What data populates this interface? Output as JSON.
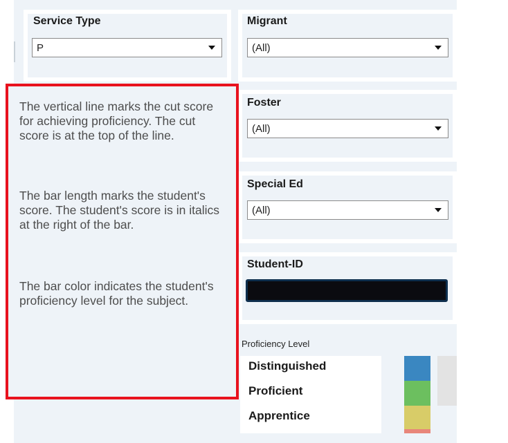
{
  "filters": {
    "service_type": {
      "label": "Service Type",
      "value": "P"
    },
    "migrant": {
      "label": "Migrant",
      "value": "(All)"
    },
    "foster": {
      "label": "Foster",
      "value": "(All)"
    },
    "special_ed": {
      "label": "Special Ed",
      "value": "(All)"
    },
    "student_id": {
      "label": "Student-ID",
      "value": ""
    }
  },
  "info": {
    "paragraph1": "The vertical line marks the cut score for achieving proficiency. The cut score is at the top of the line.",
    "paragraph2": "The bar length marks the student's score. The student's score is in italics at the right of the bar.",
    "paragraph3": "The bar color indicates the student's proficiency level for the subject."
  },
  "legend": {
    "title": "Proficiency Level",
    "items": [
      {
        "label": "Distinguished",
        "color": "#3a87c1"
      },
      {
        "label": "Proficient",
        "color": "#6cbf5f"
      },
      {
        "label": "Apprentice",
        "color": "#d8cc68"
      }
    ],
    "extra_color": "#e8867a"
  }
}
